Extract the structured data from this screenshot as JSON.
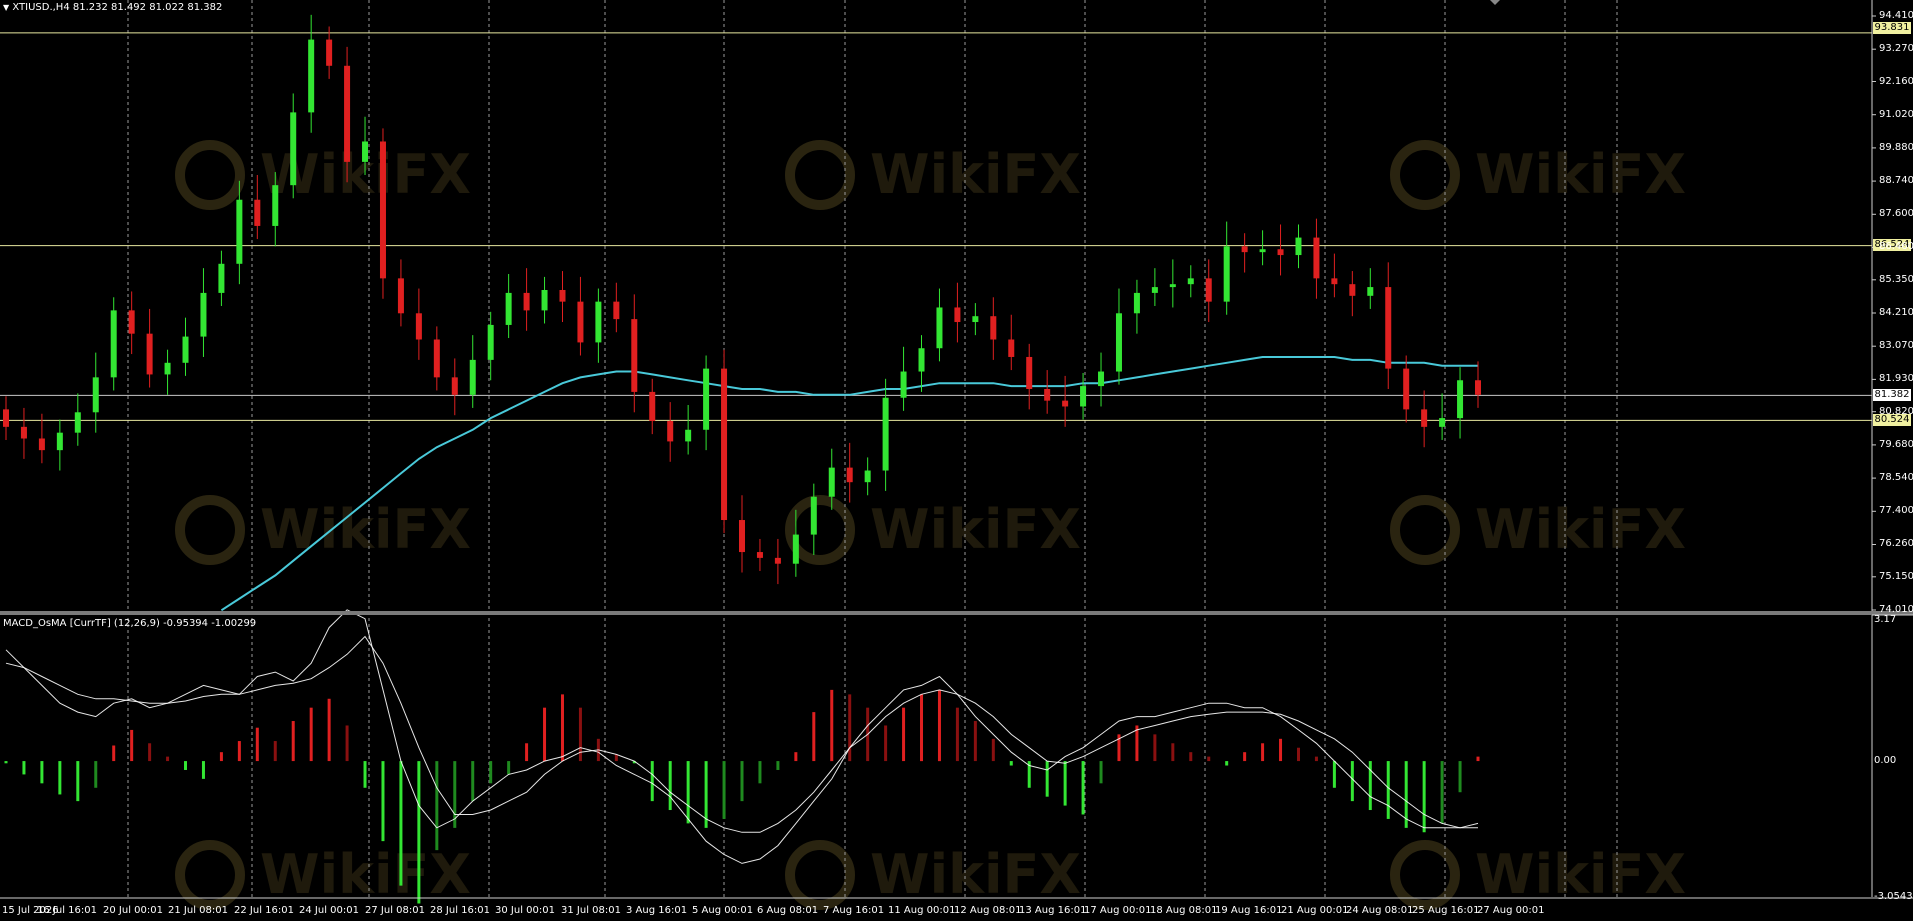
{
  "main_chart": {
    "symbol_label": "XTIUSD.,H4",
    "ohlc_label": "81.232 81.492 81.022 81.382"
  },
  "indicator": {
    "title": "MACD_OsMA [CurrTF] (12,26,9) -0.95394 -1.00299"
  },
  "colors": {
    "background": "#000000",
    "bull_candle": "#33e633",
    "bear_candle": "#e02020",
    "ma_line": "#49c9d9",
    "level_line": "#e8e8a0",
    "grid": "#9a9a9a",
    "axis_text": "#ffffff"
  },
  "price_levels": [
    {
      "label": "93.831",
      "value": 93.831
    },
    {
      "label": "86.524",
      "value": 86.524
    },
    {
      "label": "80.524",
      "value": 80.524
    }
  ],
  "current_price": {
    "label": "81.382",
    "value": 81.382
  },
  "watermark_text": "WikiFX",
  "chart_data": [
    {
      "type": "candlestick",
      "price_ticks": [
        "94.410",
        "93.270",
        "92.160",
        "91.020",
        "89.880",
        "88.740",
        "87.600",
        "86.460",
        "85.350",
        "84.210",
        "83.070",
        "81.930",
        "80.820",
        "79.680",
        "78.540",
        "77.400",
        "76.260",
        "75.150",
        "74.010"
      ],
      "price_tick_values": [
        94.41,
        93.27,
        92.16,
        91.02,
        89.88,
        88.74,
        87.6,
        86.46,
        85.35,
        84.21,
        83.07,
        81.93,
        80.82,
        79.68,
        78.54,
        77.4,
        76.26,
        75.15,
        74.01
      ],
      "time_labels": [
        "15 Jul 2026",
        "16 Jul 16:01",
        "20 Jul 00:01",
        "21 Jul 08:01",
        "22 Jul 16:01",
        "24 Jul 00:01",
        "27 Jul 08:01",
        "28 Jul 16:01",
        "30 Jul 00:01",
        "31 Jul 08:01",
        "3 Aug 16:01",
        "5 Aug 00:01",
        "6 Aug 08:01",
        "7 Aug 16:01",
        "11 Aug 00:01",
        "12 Aug 08:01",
        "13 Aug 16:01",
        "17 Aug 00:01",
        "18 Aug 08:01",
        "19 Aug 16:01",
        "21 Aug 00:01",
        "24 Aug 08:01",
        "25 Aug 16:01",
        "27 Aug 00:01"
      ],
      "close_path": [
        80.3,
        79.9,
        79.5,
        80.1,
        80.8,
        82.0,
        84.3,
        83.5,
        82.1,
        82.5,
        83.4,
        84.9,
        85.9,
        88.1,
        87.2,
        88.6,
        91.1,
        93.6,
        92.7,
        89.4,
        90.1,
        85.4,
        84.2,
        83.3,
        82.0,
        81.4,
        82.6,
        83.8,
        84.9,
        84.3,
        85.0,
        84.6,
        83.2,
        84.6,
        84.0,
        81.5,
        80.5,
        79.8,
        80.2,
        82.3,
        77.1,
        76.0,
        75.8,
        75.6,
        76.6,
        77.9,
        78.9,
        78.4,
        78.8,
        81.3,
        82.2,
        83.0,
        84.4,
        83.9,
        84.1,
        83.3,
        82.7,
        81.6,
        81.2,
        81.0,
        81.7,
        82.2,
        84.2,
        84.9,
        85.1,
        85.2,
        85.4,
        84.6,
        86.5,
        86.3,
        86.4,
        86.2,
        86.8,
        85.4,
        85.2,
        84.8,
        85.1,
        82.3,
        80.9,
        80.3,
        80.6,
        81.9,
        81.4
      ],
      "ma_path": [
        null,
        null,
        null,
        null,
        null,
        null,
        null,
        null,
        null,
        null,
        null,
        null,
        74.0,
        74.4,
        74.8,
        75.2,
        75.7,
        76.2,
        76.7,
        77.2,
        77.7,
        78.2,
        78.7,
        79.2,
        79.6,
        79.9,
        80.2,
        80.6,
        80.9,
        81.2,
        81.5,
        81.8,
        82.0,
        82.1,
        82.2,
        82.2,
        82.1,
        82.0,
        81.9,
        81.8,
        81.7,
        81.6,
        81.6,
        81.5,
        81.5,
        81.4,
        81.4,
        81.4,
        81.5,
        81.6,
        81.6,
        81.7,
        81.8,
        81.8,
        81.8,
        81.8,
        81.7,
        81.7,
        81.7,
        81.7,
        81.8,
        81.8,
        81.9,
        82.0,
        82.1,
        82.2,
        82.3,
        82.4,
        82.5,
        82.6,
        82.7,
        82.7,
        82.7,
        82.7,
        82.7,
        82.6,
        82.6,
        82.5,
        82.5,
        82.5,
        82.4,
        82.4,
        82.4
      ]
    },
    {
      "type": "macd_osma",
      "ticks": [
        "3.17",
        "0.00",
        "-3.05431"
      ],
      "tick_values": [
        3.17,
        0.0,
        -3.05431
      ],
      "osma_path": [
        -0.05,
        -0.3,
        -0.5,
        -0.75,
        -0.9,
        -0.6,
        0.35,
        0.7,
        0.4,
        0.1,
        -0.2,
        -0.4,
        0.2,
        0.45,
        0.75,
        0.45,
        0.9,
        1.2,
        1.4,
        0.8,
        -0.6,
        -1.8,
        -2.8,
        -3.2,
        -2.0,
        -1.5,
        -0.9,
        -0.5,
        -0.3,
        0.4,
        1.2,
        1.5,
        1.2,
        0.5,
        0.15,
        -0.05,
        -0.9,
        -1.1,
        -1.4,
        -1.5,
        -1.3,
        -0.9,
        -0.5,
        -0.2,
        0.2,
        1.1,
        1.6,
        1.5,
        1.2,
        0.8,
        1.2,
        1.5,
        1.6,
        1.2,
        0.9,
        0.5,
        -0.1,
        -0.6,
        -0.8,
        -1.0,
        -1.2,
        -0.5,
        0.6,
        0.8,
        0.6,
        0.4,
        0.2,
        0.1,
        -0.1,
        0.2,
        0.4,
        0.5,
        0.3,
        0.1,
        -0.6,
        -0.9,
        -1.1,
        -1.3,
        -1.5,
        -1.6,
        -1.4,
        -0.7,
        0.1
      ],
      "macd_path": [
        2.5,
        2.1,
        1.7,
        1.3,
        1.1,
        1.0,
        1.3,
        1.4,
        1.2,
        1.3,
        1.5,
        1.7,
        1.6,
        1.5,
        1.9,
        2.0,
        1.8,
        2.2,
        3.0,
        3.4,
        3.2,
        1.6,
        0.0,
        -1.0,
        -1.5,
        -1.3,
        -0.9,
        -0.6,
        -0.3,
        -0.2,
        0.0,
        0.1,
        0.3,
        0.2,
        -0.1,
        -0.3,
        -0.5,
        -0.8,
        -1.3,
        -1.8,
        -2.1,
        -2.3,
        -2.2,
        -1.9,
        -1.4,
        -0.9,
        -0.4,
        0.3,
        0.8,
        1.2,
        1.6,
        1.7,
        1.9,
        1.5,
        1.0,
        0.6,
        0.2,
        -0.1,
        -0.2,
        0.1,
        0.3,
        0.6,
        0.9,
        1.0,
        1.0,
        1.1,
        1.2,
        1.3,
        1.3,
        1.2,
        1.2,
        1.0,
        0.7,
        0.4,
        0.0,
        -0.4,
        -0.8,
        -1.0,
        -1.3,
        -1.5,
        -1.5,
        -1.5,
        -1.4
      ],
      "signal_path": [
        2.2,
        2.1,
        1.9,
        1.7,
        1.5,
        1.4,
        1.4,
        1.35,
        1.3,
        1.3,
        1.35,
        1.45,
        1.5,
        1.5,
        1.6,
        1.7,
        1.75,
        1.85,
        2.1,
        2.4,
        2.8,
        2.2,
        1.3,
        0.3,
        -0.6,
        -1.2,
        -1.2,
        -1.1,
        -0.9,
        -0.7,
        -0.3,
        0.0,
        0.2,
        0.25,
        0.15,
        0.0,
        -0.3,
        -0.7,
        -1.0,
        -1.3,
        -1.5,
        -1.6,
        -1.6,
        -1.4,
        -1.1,
        -0.7,
        -0.2,
        0.3,
        0.6,
        1.0,
        1.3,
        1.5,
        1.6,
        1.5,
        1.3,
        1.0,
        0.6,
        0.3,
        0.0,
        -0.05,
        0.1,
        0.3,
        0.5,
        0.7,
        0.8,
        0.9,
        1.0,
        1.05,
        1.1,
        1.1,
        1.1,
        1.05,
        0.9,
        0.7,
        0.5,
        0.2,
        -0.2,
        -0.6,
        -0.9,
        -1.2,
        -1.4,
        -1.5,
        -1.5
      ]
    }
  ]
}
